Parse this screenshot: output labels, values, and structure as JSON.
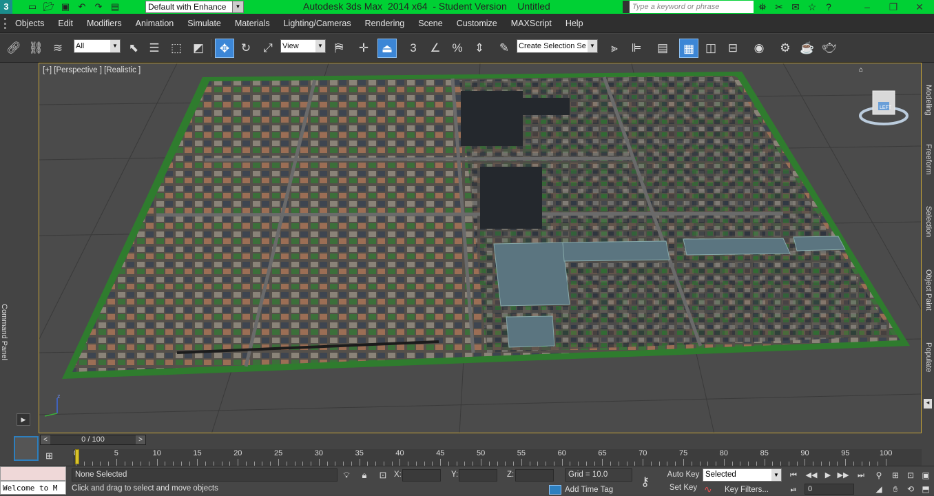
{
  "titlebar": {
    "app_icon": "3ds-max-logo-icon",
    "workspace": "Default with Enhance",
    "title": "Autodesk 3ds Max  2014 x64  - Student Version    Untitled",
    "search_placeholder": "Type a keyword or phrase",
    "window_buttons": [
      "–",
      "❐",
      "✕"
    ]
  },
  "menu": {
    "items": [
      "Objects",
      "Edit",
      "Modifiers",
      "Animation",
      "Simulate",
      "Materials",
      "Lighting/Cameras",
      "Rendering",
      "Scene",
      "Customize",
      "MAXScript",
      "Help"
    ]
  },
  "toolbar": {
    "filter_value": "All",
    "ref_coord_value": "View",
    "selection_set_placeholder": "Create Selection Se",
    "snap_label": "3",
    "angle_snap_label": "∠",
    "percent_snap_label": "%"
  },
  "viewport": {
    "label": "[+] [Perspective ] [Realistic ]",
    "viewcube_face": "LEFT",
    "axis_z": "z"
  },
  "left_strip": {
    "command_panel_label": "Command Panel"
  },
  "right_tabs": [
    "Modeling",
    "Freeform",
    "Selection",
    "Object Paint",
    "Populate"
  ],
  "time_slider": {
    "value": "0 / 100",
    "prev": "<",
    "next": ">"
  },
  "track_bar": {
    "labels": [
      "0",
      "5",
      "10",
      "15",
      "20",
      "25",
      "30",
      "35",
      "40",
      "45",
      "50",
      "55",
      "60",
      "65",
      "70",
      "75",
      "80",
      "85",
      "90",
      "95",
      "100"
    ]
  },
  "status": {
    "maxscript_text": "Welcome to M",
    "selection": "None Selected",
    "prompt": "Click and drag to select and move objects",
    "x_label": "X:",
    "y_label": "Y:",
    "z_label": "Z:",
    "grid": "Grid = 10.0",
    "add_time_tag": "Add Time Tag",
    "auto_key": "Auto Key",
    "set_key": "Set Key",
    "selected_value": "Selected",
    "key_filters": "Key Filters...",
    "frame_value": "0"
  },
  "colors": {
    "titlebar_bg": "#00d034",
    "viewport_border": "#c7a538",
    "active_tool": "#3c86d6",
    "time_cursor": "#d9c32b"
  }
}
